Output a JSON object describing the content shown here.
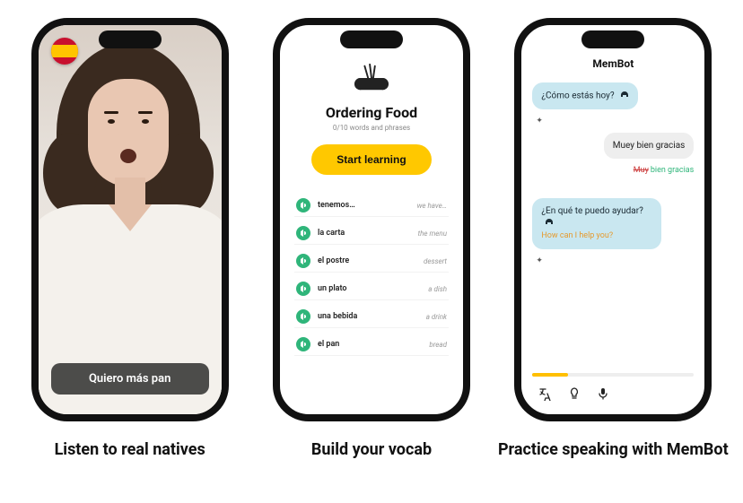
{
  "phone1": {
    "flag_country": "Spain",
    "subtitle": "Quiero más pan"
  },
  "phone2": {
    "lesson_title": "Ordering Food",
    "lesson_subtitle": "0/10 words and phrases",
    "start_label": "Start learning",
    "items": [
      {
        "term": "tenemos…",
        "translation": "we have…"
      },
      {
        "term": "la carta",
        "translation": "the menu"
      },
      {
        "term": "el postre",
        "translation": "dessert"
      },
      {
        "term": "un plato",
        "translation": "a dish"
      },
      {
        "term": "una bebida",
        "translation": "a drink"
      },
      {
        "term": "el pan",
        "translation": "bread"
      }
    ]
  },
  "phone3": {
    "header": "MemBot",
    "messages": {
      "bot1": "¿Cómo estás hoy?",
      "user1": "Muey bien gracias",
      "correction_wrong": "Muy",
      "correction_right": "bien gracias",
      "bot2": "¿En qué te puedo ayudar?",
      "bot2_translation": "How can I help you?"
    }
  },
  "captions": {
    "c1": "Listen to real natives",
    "c2": "Build your vocab",
    "c3": "Practice speaking with MemBot"
  }
}
